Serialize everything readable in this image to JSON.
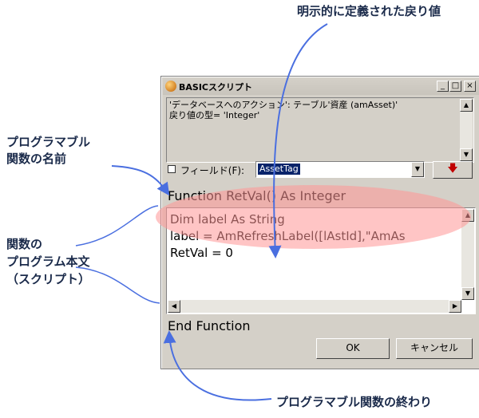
{
  "callouts": {
    "return_value": "明示的に定義された戻り値",
    "func_name_1": "プログラマブル",
    "func_name_2": "関数の名前",
    "body_1": "関数の",
    "body_2": "プログラム本文",
    "body_3": "（スクリプト）",
    "func_end": "プログラマブル関数の終わり"
  },
  "window": {
    "title": "BASICスクリプト",
    "info_line_1": "'データベースへのアクション': テーブル'資産 (amAsset)'",
    "info_line_2": "戻り値の型= 'Integer'",
    "field_label": "フィールド(F):",
    "field_value": "AssetTag",
    "function_header": "Function RetVal() As Integer",
    "code_lines": [
      "Dim label As String",
      "label = AmRefreshLabel([lAstId],\"AmAs",
      "RetVal = 0"
    ],
    "function_footer": "End Function",
    "ok_label": "OK",
    "cancel_label": "キャンセル"
  },
  "colors": {
    "callout_arrow": "#4a6fe0",
    "highlight": "#ff9696",
    "selection": "#0a246a"
  }
}
